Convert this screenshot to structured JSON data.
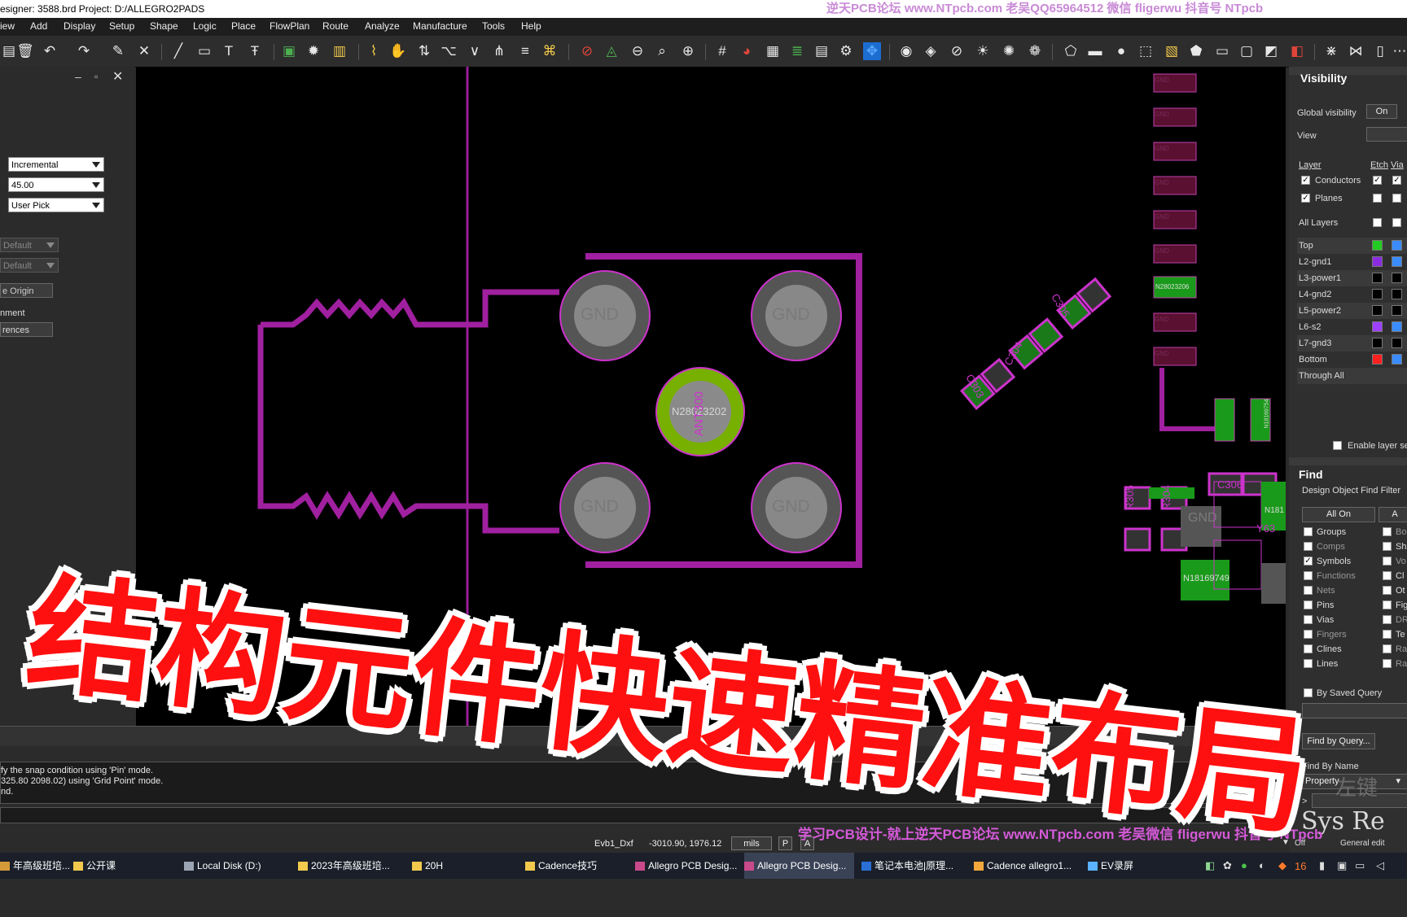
{
  "title_bar": {
    "text": "esigner: 3588.brd  Project: D:/ALLEGRO2PADS",
    "watermark": "逆天PCB论坛 www.NTpcb.com 老吴QQ65964512  微信 fligerwu 抖音号 NTpcb"
  },
  "menu": [
    "iew",
    "Add",
    "Display",
    "Setup",
    "Shape",
    "Logic",
    "Place",
    "FlowPlan",
    "Route",
    "Analyze",
    "Manufacture",
    "Tools",
    "Help"
  ],
  "left_panel": {
    "snap_mode": "Incremental",
    "angle": "45.00",
    "pick": "User Pick",
    "default_1": "Default",
    "default_2": "Default",
    "origin_btn": "e Origin",
    "alignment_label": "nment",
    "references_btn": "rences"
  },
  "canvas": {
    "pad_label": "GND",
    "center_net": "N28023202",
    "center_refdes": "ANT300",
    "right_net": "N28023206",
    "refdes": [
      "C303",
      "C304",
      "C305",
      "C306",
      "C307",
      "R305",
      "R304",
      "Y63",
      "C306"
    ],
    "net_left_bottom": "N18169749",
    "net_right_box": "N181",
    "vertical_net": "N18169754"
  },
  "visibility": {
    "title": "Visibility",
    "global_label": "Global visibility",
    "global_value": "On",
    "view_label": "View",
    "col_layer": "Layer",
    "col_etch": "Etch",
    "col_via": "Via",
    "groups": [
      {
        "name": "Conductors"
      },
      {
        "name": "Planes"
      }
    ],
    "all_layers": "All Layers",
    "layers": [
      {
        "name": "Top",
        "color": "#22cc22",
        "via": "#3a8cff"
      },
      {
        "name": "L2-gnd1",
        "color": "#8a2be2",
        "via": "#3a8cff"
      },
      {
        "name": "L3-power1",
        "color": "#000000",
        "via": "#000000"
      },
      {
        "name": "L4-gnd2",
        "color": "#000000",
        "via": "#000000"
      },
      {
        "name": "L5-power2",
        "color": "#000000",
        "via": "#000000"
      },
      {
        "name": "L6-s2",
        "color": "#a040ff",
        "via": "#3a8cff"
      },
      {
        "name": "L7-gnd3",
        "color": "#000000",
        "via": "#000000"
      },
      {
        "name": "Bottom",
        "color": "#ff2020",
        "via": "#3a8cff"
      }
    ],
    "through_all": "Through All",
    "enable_layer": "Enable layer se"
  },
  "find": {
    "title": "Find",
    "filter_title": "Design Object Find Filter",
    "all_on": "All On",
    "all_off": "A",
    "items": [
      {
        "name": "Groups",
        "checked": false
      },
      {
        "name": "Comps",
        "checked": false
      },
      {
        "name": "Symbols",
        "checked": true
      },
      {
        "name": "Functions",
        "checked": false
      },
      {
        "name": "Nets",
        "checked": false
      },
      {
        "name": "Pins",
        "checked": false
      },
      {
        "name": "Vias",
        "checked": false
      },
      {
        "name": "Fingers",
        "checked": false
      },
      {
        "name": "Clines",
        "checked": false
      },
      {
        "name": "Lines",
        "checked": false
      }
    ],
    "items2": [
      "Bo",
      "Sh",
      "Vo",
      "Cl",
      "Ot",
      "Fig",
      "DR",
      "Te",
      "Ra",
      "Ra"
    ],
    "saved_query": "By Saved Query",
    "find_by_query": "Find by Query...",
    "find_by_name": "Find By Name",
    "property": "Property",
    "gt": ">"
  },
  "command": {
    "line1": "fy the snap condition using 'Pin' mode.",
    "line2": "325.80 2098.02) using 'Grid Point' mode.",
    "line3": "nd."
  },
  "status": {
    "layer": "Evb1_Dxf",
    "coords": "-3010.90, 1976.12",
    "units": "mils",
    "p": "P",
    "a": "A",
    "off": "Off",
    "general": "General edit"
  },
  "watermark_bottom": "学习PCB设计-就上逆天PCB论坛 www.NTpcb.com 老吴微信 fligerwu 抖音号 NTpcb",
  "overlay_text": "结构元件快速精准布局",
  "right_corner_text": "Sys Re",
  "handwriting": "左键",
  "taskbar": [
    {
      "label": "年高级班培...",
      "icon": "#d49a3a"
    },
    {
      "label": "公开课",
      "icon": "#f2c94c"
    },
    {
      "label": "Local Disk (D:)",
      "icon": "#9aa4b2"
    },
    {
      "label": "2023年高级班培...",
      "icon": "#f2c94c"
    },
    {
      "label": "20H",
      "icon": "#f2c94c"
    },
    {
      "label": "Cadence技巧",
      "icon": "#f2c94c"
    },
    {
      "label": "Allegro PCB Desig...",
      "icon": "#c84a8a"
    },
    {
      "label": "Allegro PCB Desig...",
      "icon": "#c84a8a"
    },
    {
      "label": "笔记本电池|原理...",
      "icon": "#2a6fd6"
    },
    {
      "label": "Cadence allegro1...",
      "icon": "#f2a83a"
    },
    {
      "label": "EV录屏",
      "icon": "#5ab2ff"
    }
  ],
  "tray_number": "16"
}
